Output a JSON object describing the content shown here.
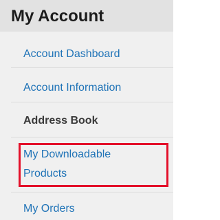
{
  "sidebar": {
    "title": "My Account",
    "items": [
      {
        "label": "Account Dashboard",
        "current": false
      },
      {
        "label": "Account Information",
        "current": false
      },
      {
        "label": "Address Book",
        "current": true
      },
      {
        "label": "My Downloadable Products",
        "current": false
      },
      {
        "label": "My Orders",
        "current": false
      }
    ]
  },
  "colors": {
    "link": "#1f73b7",
    "current": "#3a3a3a",
    "title_bg": "#e2e2e2",
    "panel_bg": "#f0f0f0",
    "highlight": "#e3102a"
  }
}
